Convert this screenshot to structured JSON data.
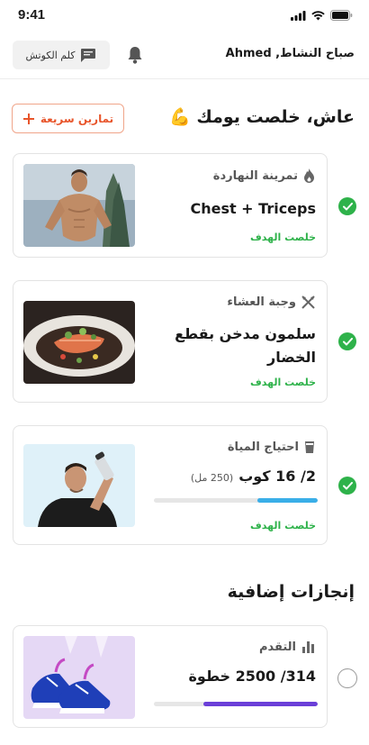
{
  "status_bar": {
    "time": "9:41"
  },
  "header": {
    "greeting": "صباح النشاط, Ahmed",
    "coach_label": "كلم الكوتش"
  },
  "today": {
    "title": "عاش، خلصت يومك 💪",
    "quick_button": "تمارين سريعة"
  },
  "cards": [
    {
      "category": "تمرينة النهاردة",
      "title": "Chest + Triceps",
      "goal": "خلصت الهدف",
      "status": "done",
      "icon": "flame-icon"
    },
    {
      "category": "وجبة العشاء",
      "title": "سلمون مدخن بقطع الخضار",
      "goal": "خلصت الهدف",
      "status": "done",
      "icon": "utensils-icon"
    },
    {
      "category": "احتياج المياة",
      "amount": "2/ 16 كوب",
      "unit": "(250 مل)",
      "goal": "خلصت الهدف",
      "status": "done",
      "progress": 0.37,
      "progress_color": "#3aaee8",
      "icon": "water-glass-icon"
    }
  ],
  "extra": {
    "title": "إنجازات إضافية",
    "card": {
      "category": "التقدم",
      "amount": "314/ 2500 خطوة",
      "status": "pending",
      "progress": 0.7,
      "progress_color": "#6a3fd8",
      "icon": "bar-chart-icon"
    }
  },
  "colors": {
    "accent": "#e8552b",
    "success": "#2eb24a",
    "water": "#3aaee8",
    "steps": "#6a3fd8"
  }
}
